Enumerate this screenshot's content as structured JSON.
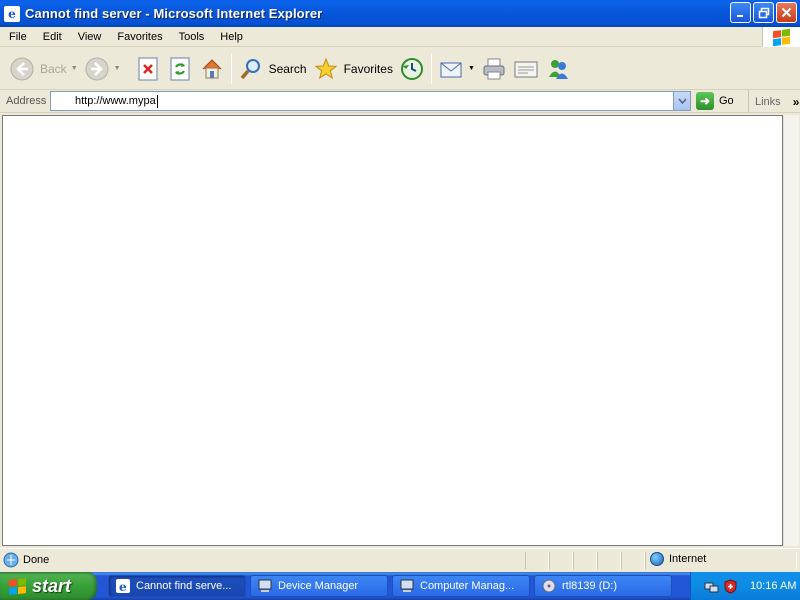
{
  "window": {
    "title": "Cannot find server - Microsoft Internet Explorer",
    "caption_buttons": {
      "minimize": "minimize-icon",
      "restore": "restore-icon",
      "close": "close-icon"
    }
  },
  "menubar": {
    "items": [
      "File",
      "Edit",
      "View",
      "Favorites",
      "Tools",
      "Help"
    ]
  },
  "toolbar": {
    "back_label": "Back",
    "search_label": "Search",
    "favorites_label": "Favorites"
  },
  "address_bar": {
    "label": "Address",
    "value": "http://www.mypa",
    "go_label": "Go",
    "links_label": "Links",
    "chevron": "»"
  },
  "statusbar": {
    "status_text": "Done",
    "zone_text": "Internet"
  },
  "taskbar": {
    "start_label": "start",
    "tasks": [
      {
        "label": "Cannot find serve...",
        "icon": "ie-icon",
        "active": true
      },
      {
        "label": "Device Manager",
        "icon": "computer-icon",
        "active": false
      },
      {
        "label": "Computer Manag...",
        "icon": "computer-icon",
        "active": false
      },
      {
        "label": "rtl8139 (D:)",
        "icon": "cd-drive-icon",
        "active": false
      }
    ],
    "clock": "10:16 AM"
  },
  "colors": {
    "titlebar": "#0858dc",
    "taskbar": "#2157d7",
    "start_button": "#37a037",
    "tray": "#0d8ce5"
  }
}
